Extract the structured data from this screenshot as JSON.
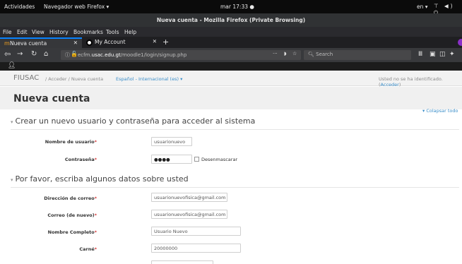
{
  "topbar": {
    "activities": "Actividades",
    "app_menu": "Navegador web Firefox ▾",
    "clock": "mar 17:33 ●",
    "lang": "en ▾",
    "sys_icons": "⊤ ◀) ⏻"
  },
  "window_title": "Nueva cuenta - Mozilla Firefox (Private Browsing)",
  "menu": [
    "File",
    "Edit",
    "View",
    "History",
    "Bookmarks",
    "Tools",
    "Help"
  ],
  "tabs": [
    {
      "title": "Nueva cuenta",
      "close": "✕"
    },
    {
      "title": "My Account",
      "close": "✕"
    }
  ],
  "new_tab": "+",
  "url": {
    "prefix": "ecfm.",
    "domain": "usac.edu.gt",
    "path": "/moodle1/login/signup.php"
  },
  "search_placeholder": "Search",
  "moodle": {
    "brand": "FIUSAC",
    "breadcrumb": "/ Acceder / Nueva cuenta",
    "language": "Español - Internacional (es) ▾",
    "login_text": "Usted no se ha identificado. (",
    "login_link": "Acceder",
    "login_close": ")"
  },
  "page_title": "Nueva cuenta",
  "collapse_all": "▾ Colapsar todo",
  "sections": {
    "account": "Crear un nuevo usuario y contraseña para acceder al sistema",
    "details": "Por favor, escriba algunos datos sobre usted"
  },
  "fields": {
    "username": {
      "label": "Nombre de usuario",
      "value": "usuarionuevo"
    },
    "password": {
      "label": "Contraseña",
      "value": "●●●●",
      "unmask": "Desenmascarar"
    },
    "email": {
      "label": "Dirección de correo",
      "value": "usuarionuevofisica@gmail.com"
    },
    "email2": {
      "label": "Correo (de nuevo)",
      "value": "usuarionuevofisica@gmail.com"
    },
    "fullname": {
      "label": "Nombre Completo",
      "value": "Usuario Nuevo"
    },
    "carne": {
      "label": "Carné",
      "value": "20000000"
    }
  },
  "required_mark": "*",
  "colors": {
    "link": "#3a8ec9",
    "required": "#cc0000",
    "tab_accent": "#0a84ff",
    "private_badge": "#8b2fc9"
  }
}
